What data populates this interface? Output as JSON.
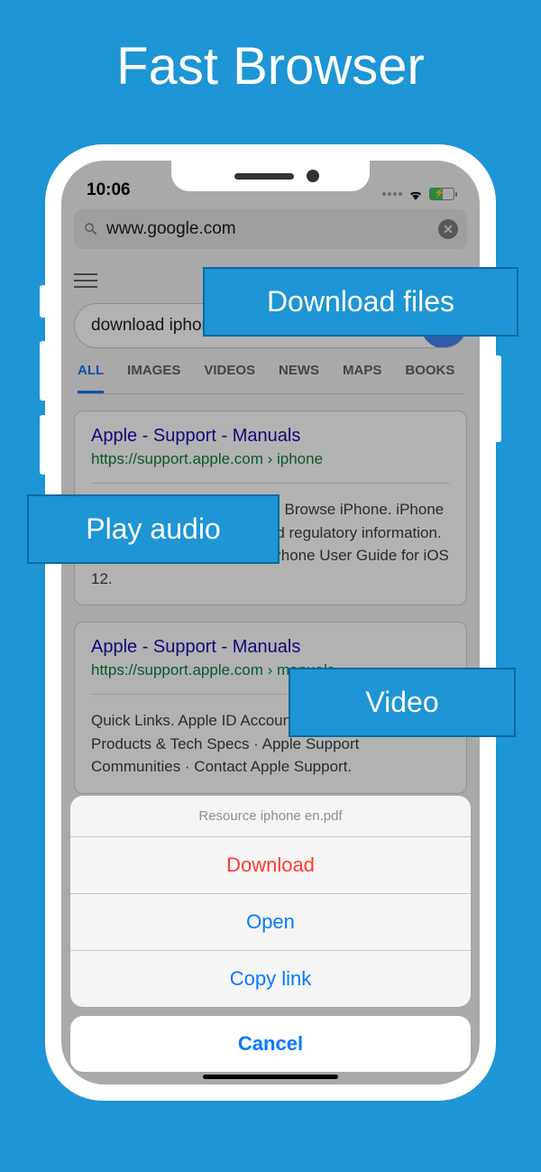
{
  "hero": {
    "title": "Fast Browser"
  },
  "callouts": {
    "download_files": "Download files",
    "play_audio": "Play audio",
    "video": "Video"
  },
  "statusbar": {
    "time": "10:06"
  },
  "urlbar": {
    "url": "www.google.com"
  },
  "search": {
    "query": "download iphone manual pdf"
  },
  "tabs": [
    "ALL",
    "IMAGES",
    "VIDEOS",
    "NEWS",
    "MAPS",
    "BOOKS"
  ],
  "results": [
    {
      "title": "Apple - Support - Manuals",
      "url": "https://support.apple.com › iphone",
      "desc": "iPhone. Browse by Product. Browse iPhone. iPhone X Info - safety, warranty, and regulatory information. Sep 21, 2018 - 100 KB ... iPhone User Guide for iOS 12."
    },
    {
      "title": "Apple - Support - Manuals",
      "url": "https://support.apple.com › manuals",
      "desc": "Quick Links. Apple ID Account Page · Apple Products & Tech Specs · Apple Support Communities · Contact Apple Support."
    }
  ],
  "sheet": {
    "title": "Resource iphone  en.pdf",
    "download": "Download",
    "open": "Open",
    "copy": "Copy link",
    "cancel": "Cancel"
  }
}
